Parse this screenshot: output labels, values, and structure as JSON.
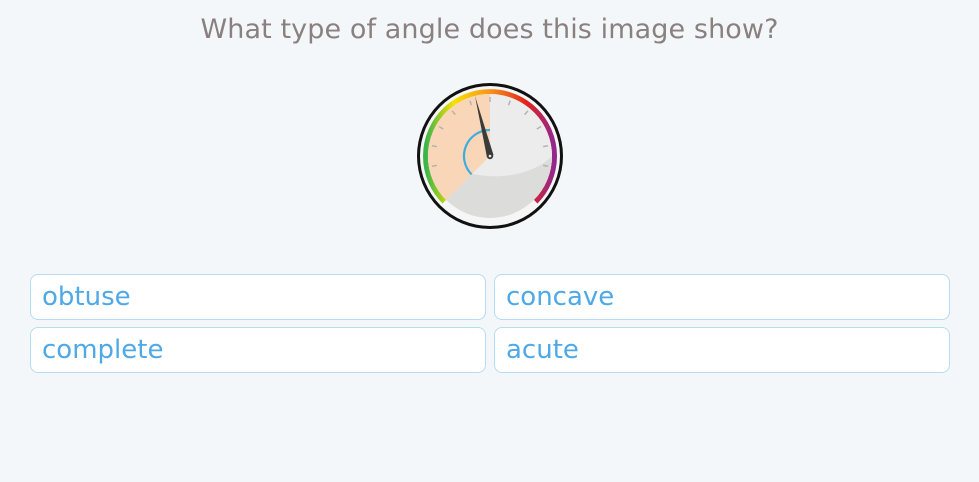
{
  "question": {
    "text": "What type of angle does this image show?"
  },
  "gauge": {
    "icon": "gauge-icon",
    "colors": {
      "rim": "#111111",
      "face": "#ececec",
      "face_shadow": "#dcdcda",
      "angle_fill": "#fad6b8",
      "needle": "#3a3a3a",
      "arc_marker": "#3aaee0",
      "band": [
        "#39b54a",
        "#f7e100",
        "#f7941d",
        "#e2231a",
        "#92278f"
      ]
    }
  },
  "answers": {
    "options": [
      {
        "label": "obtuse"
      },
      {
        "label": "concave"
      },
      {
        "label": "complete"
      },
      {
        "label": "acute"
      }
    ]
  }
}
